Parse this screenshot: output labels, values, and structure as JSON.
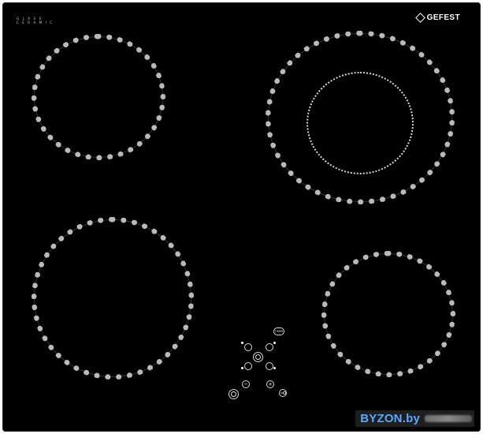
{
  "product": {
    "brand": "GEFEST",
    "glass_label_line1": "G L A S S",
    "glass_label_line2": "C E R A M I C"
  },
  "zones": [
    {
      "name": "back-left",
      "type": "single"
    },
    {
      "name": "back-right",
      "type": "dual"
    },
    {
      "name": "front-left",
      "type": "single"
    },
    {
      "name": "front-right",
      "type": "single"
    }
  ],
  "controls": {
    "timer_label": "TIMER",
    "minus_symbol": "−",
    "plus_symbol": "+",
    "power_icon": "power-icon",
    "lock_icon": "key-lock-icon",
    "select_icon": "zone-select-icon"
  },
  "watermark": {
    "text": "BYZON.by"
  },
  "colors": {
    "glass": "#000000",
    "ring": "#b9b9b9",
    "watermark": "#5aa7ff"
  }
}
